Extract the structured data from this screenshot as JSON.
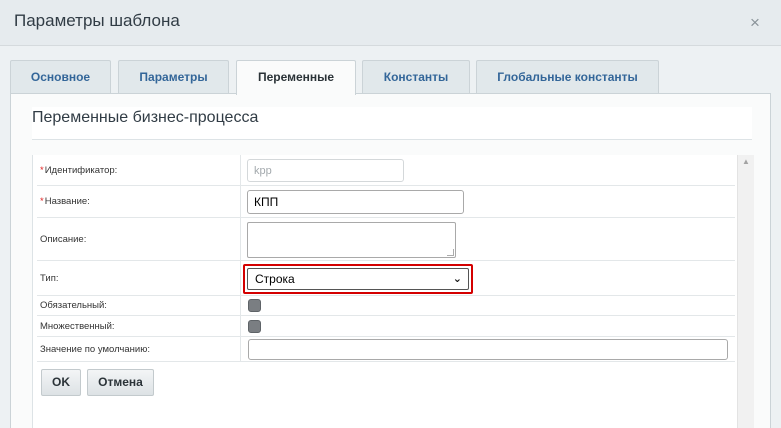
{
  "dialog": {
    "title": "Параметры шаблона",
    "close_icon": "close-icon",
    "close_glyph": "×"
  },
  "tabs": [
    {
      "label": "Основное",
      "active": false
    },
    {
      "label": "Параметры",
      "active": false
    },
    {
      "label": "Переменные",
      "active": true
    },
    {
      "label": "Константы",
      "active": false
    },
    {
      "label": "Глобальные константы",
      "active": false
    }
  ],
  "section": {
    "title": "Переменные бизнес-процесса"
  },
  "form": {
    "identifier": {
      "label": "Идентификатор:",
      "required_mark": "*",
      "value": "kpp"
    },
    "name": {
      "label": "Название:",
      "required_mark": "*",
      "value": "КПП"
    },
    "description": {
      "label": "Описание:",
      "value": ""
    },
    "type": {
      "label": "Тип:",
      "selected": "Строка"
    },
    "required": {
      "label": "Обязательный:",
      "checked": false
    },
    "multiple": {
      "label": "Множественный:",
      "checked": false
    },
    "default_value": {
      "label": "Значение по умолчанию:",
      "value": ""
    }
  },
  "buttons": {
    "ok": "OK",
    "cancel": "Отмена"
  },
  "colors": {
    "accent_tab_text": "#336699",
    "highlight_border": "#d40000",
    "required_mark": "#e02020"
  }
}
